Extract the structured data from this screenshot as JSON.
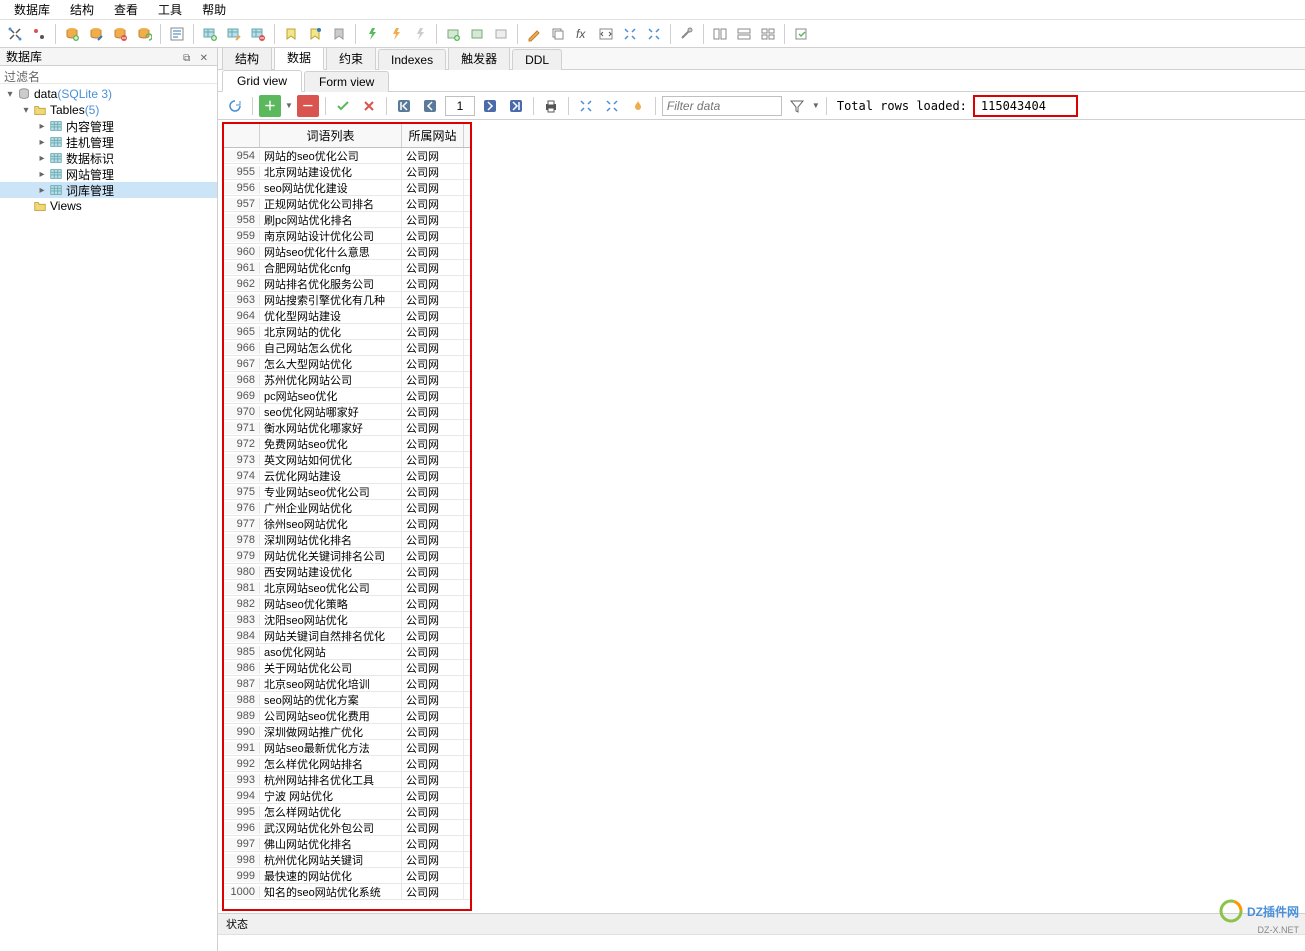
{
  "menu": [
    "数据库",
    "结构",
    "查看",
    "工具",
    "帮助"
  ],
  "sidebar": {
    "title": "数据库",
    "filter": "过滤名",
    "tree": [
      {
        "indent": 0,
        "exp": "▾",
        "ico": "db",
        "label": "data",
        "type": "(SQLite 3)",
        "sel": false
      },
      {
        "indent": 1,
        "exp": "▾",
        "ico": "folder",
        "label": "Tables",
        "type": "(5)",
        "sel": false
      },
      {
        "indent": 2,
        "exp": "▸",
        "ico": "table",
        "label": "内容管理",
        "type": "",
        "sel": false
      },
      {
        "indent": 2,
        "exp": "▸",
        "ico": "table",
        "label": "挂机管理",
        "type": "",
        "sel": false
      },
      {
        "indent": 2,
        "exp": "▸",
        "ico": "table",
        "label": "数据标识",
        "type": "",
        "sel": false
      },
      {
        "indent": 2,
        "exp": "▸",
        "ico": "table",
        "label": "网站管理",
        "type": "",
        "sel": false
      },
      {
        "indent": 2,
        "exp": "▸",
        "ico": "table",
        "label": "词库管理",
        "type": "",
        "sel": true
      },
      {
        "indent": 1,
        "exp": "",
        "ico": "views",
        "label": "Views",
        "type": "",
        "sel": false
      }
    ]
  },
  "tabs": [
    {
      "label": "结构",
      "active": false
    },
    {
      "label": "数据",
      "active": true
    },
    {
      "label": "约束",
      "active": false
    },
    {
      "label": "Indexes",
      "active": false
    },
    {
      "label": "触发器",
      "active": false
    },
    {
      "label": "DDL",
      "active": false
    }
  ],
  "subtabs": [
    {
      "label": "Grid view",
      "active": true
    },
    {
      "label": "Form view",
      "active": false
    }
  ],
  "databar": {
    "page": "1",
    "filter_placeholder": "Filter data",
    "total_label": "Total rows loaded:",
    "total_value": "115043404"
  },
  "grid": {
    "headers": [
      "",
      "词语列表",
      "所属网站"
    ],
    "rows": [
      [
        "954",
        "网站的seo优化公司",
        "公司网"
      ],
      [
        "955",
        "北京网站建设优化",
        "公司网"
      ],
      [
        "956",
        "seo网站优化建设",
        "公司网"
      ],
      [
        "957",
        "正规网站优化公司排名",
        "公司网"
      ],
      [
        "958",
        "刷pc网站优化排名",
        "公司网"
      ],
      [
        "959",
        "南京网站设计优化公司",
        "公司网"
      ],
      [
        "960",
        "网站seo优化什么意思",
        "公司网"
      ],
      [
        "961",
        "合肥网站优化cnfg",
        "公司网"
      ],
      [
        "962",
        "网站排名优化服务公司",
        "公司网"
      ],
      [
        "963",
        "网站搜索引擎优化有几种",
        "公司网"
      ],
      [
        "964",
        "优化型网站建设",
        "公司网"
      ],
      [
        "965",
        "北京网站的优化",
        "公司网"
      ],
      [
        "966",
        "自己网站怎么优化",
        "公司网"
      ],
      [
        "967",
        "怎么大型网站优化",
        "公司网"
      ],
      [
        "968",
        "苏州优化网站公司",
        "公司网"
      ],
      [
        "969",
        "pc网站seo优化",
        "公司网"
      ],
      [
        "970",
        "seo优化网站哪家好",
        "公司网"
      ],
      [
        "971",
        "衡水网站优化哪家好",
        "公司网"
      ],
      [
        "972",
        "免费网站seo优化",
        "公司网"
      ],
      [
        "973",
        "英文网站如何优化",
        "公司网"
      ],
      [
        "974",
        "云优化网站建设",
        "公司网"
      ],
      [
        "975",
        "专业网站seo优化公司",
        "公司网"
      ],
      [
        "976",
        "广州企业网站优化",
        "公司网"
      ],
      [
        "977",
        "徐州seo网站优化",
        "公司网"
      ],
      [
        "978",
        "深圳网站优化排名",
        "公司网"
      ],
      [
        "979",
        "网站优化关键词排名公司",
        "公司网"
      ],
      [
        "980",
        "西安网站建设优化",
        "公司网"
      ],
      [
        "981",
        "北京网站seo优化公司",
        "公司网"
      ],
      [
        "982",
        "网站seo优化策略",
        "公司网"
      ],
      [
        "983",
        "沈阳seo网站优化",
        "公司网"
      ],
      [
        "984",
        "网站关键词自然排名优化",
        "公司网"
      ],
      [
        "985",
        "aso优化网站",
        "公司网"
      ],
      [
        "986",
        "关于网站优化公司",
        "公司网"
      ],
      [
        "987",
        "北京seo网站优化培训",
        "公司网"
      ],
      [
        "988",
        "seo网站的优化方案",
        "公司网"
      ],
      [
        "989",
        "公司网站seo优化费用",
        "公司网"
      ],
      [
        "990",
        "深圳做网站推广优化",
        "公司网"
      ],
      [
        "991",
        "网站seo最新优化方法",
        "公司网"
      ],
      [
        "992",
        "怎么样优化网站排名",
        "公司网"
      ],
      [
        "993",
        "杭州网站排名优化工具",
        "公司网"
      ],
      [
        "994",
        "宁波 网站优化",
        "公司网"
      ],
      [
        "995",
        "怎么样网站优化",
        "公司网"
      ],
      [
        "996",
        "武汉网站优化外包公司",
        "公司网"
      ],
      [
        "997",
        "佛山网站优化排名",
        "公司网"
      ],
      [
        "998",
        "杭州优化网站关键词",
        "公司网"
      ],
      [
        "999",
        "最快速的网站优化",
        "公司网"
      ],
      [
        "1000",
        "知名的seo网站优化系统",
        "公司网"
      ]
    ]
  },
  "status": "状态",
  "watermark": {
    "main": "DZ插件网",
    "sub": "DZ-X.NET"
  }
}
